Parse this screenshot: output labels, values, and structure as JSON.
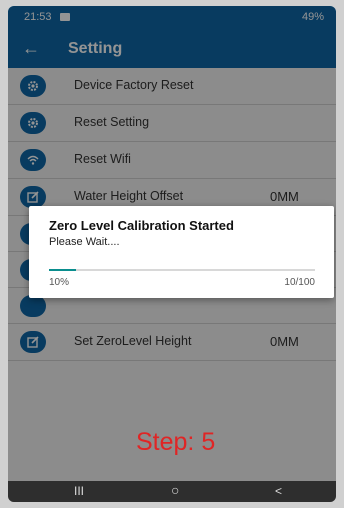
{
  "status": {
    "time": "21:53",
    "right": "49%"
  },
  "appbar": {
    "back": "←",
    "title": "Setting"
  },
  "settings": [
    {
      "label": "Device Factory Reset",
      "value": "",
      "icon": "gear-icon"
    },
    {
      "label": "Reset Setting",
      "value": "",
      "icon": "gear-icon"
    },
    {
      "label": "Reset Wifi",
      "value": "",
      "icon": "wifi-icon"
    },
    {
      "label": "Water Height Offset",
      "value": "0MM",
      "icon": "edit-icon"
    }
  ],
  "settings_bottom": {
    "label": "Set ZeroLevel Height",
    "value": "0MM",
    "icon": "edit-icon"
  },
  "dialog": {
    "title": "Zero Level Calibration Started",
    "message": "Please Wait....",
    "progress_fraction": 0.1,
    "percent_label": "10%",
    "count_label": "10/100"
  },
  "caption": "Step: 5",
  "navbar": {
    "recents": "III",
    "home": "○",
    "back": "<"
  },
  "colors": {
    "primary": "#0e67a6",
    "progress": "#0a8e8e",
    "caption": "#e02525"
  }
}
